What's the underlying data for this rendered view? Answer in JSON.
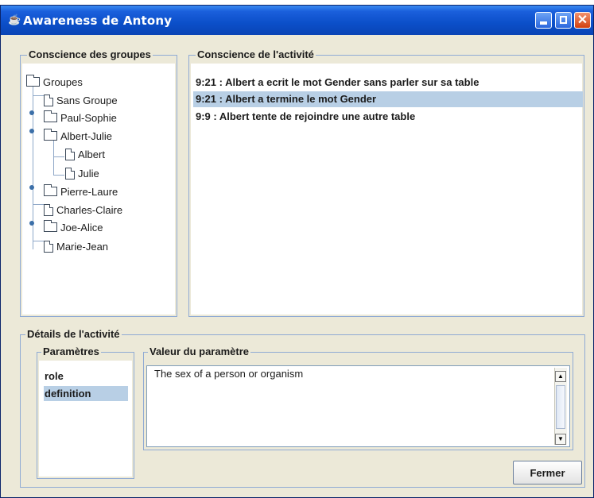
{
  "window": {
    "title": "Awareness de Antony"
  },
  "groups_panel": {
    "legend": "Conscience des groupes",
    "tree": [
      {
        "label": "Groupes"
      },
      {
        "label": "Sans Groupe"
      },
      {
        "label": "Paul-Sophie"
      },
      {
        "label": "Albert-Julie"
      },
      {
        "label": "Albert"
      },
      {
        "label": "Julie"
      },
      {
        "label": "Pierre-Laure"
      },
      {
        "label": "Charles-Claire"
      },
      {
        "label": "Joe-Alice"
      },
      {
        "label": "Marie-Jean"
      }
    ]
  },
  "activity_panel": {
    "legend": "Conscience de l'activité",
    "lines": [
      "9:21 : Albert a ecrit le mot Gender sans parler sur sa table",
      "9:21 : Albert a termine le mot Gender",
      "9:9 : Albert tente de rejoindre une autre table"
    ],
    "selected_index": 1
  },
  "details": {
    "legend": "Détails de l'activité",
    "params_legend": "Paramètres",
    "params": [
      "role",
      "definition"
    ],
    "selected_param": 1,
    "value_legend": "Valeur du paramètre",
    "value_text": "The sex of a person or organism"
  },
  "buttons": {
    "close": "Fermer"
  }
}
